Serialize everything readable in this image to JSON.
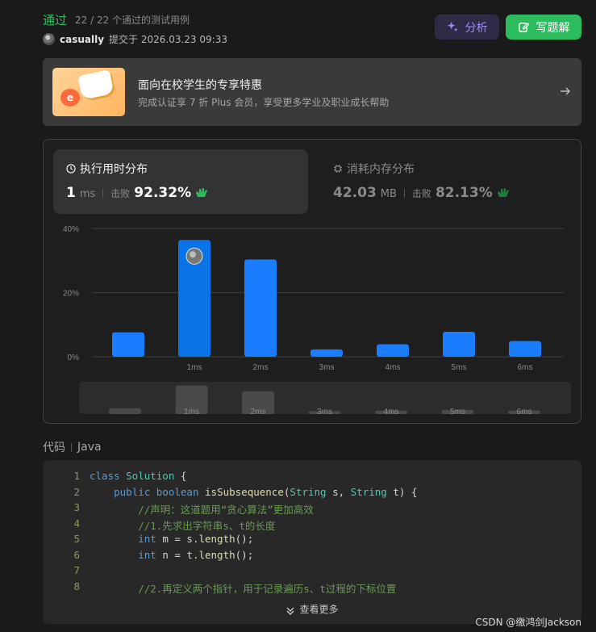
{
  "submission": {
    "status": "通过",
    "passed": "22 / 22 个通过的测试用例",
    "user": "casually",
    "submitted_at": "提交于 2026.03.23 09:33"
  },
  "actions": {
    "analyze": "分析",
    "write_solution": "写题解"
  },
  "promo": {
    "title": "面向在校学生的专享特惠",
    "subtitle": "完成认证享 7 折 Plus 会员，享受更多学业及职业成长帮助"
  },
  "runtime": {
    "label": "执行用时分布",
    "value": "1",
    "unit": "ms",
    "beat_label": "击败",
    "beat": "92.32%"
  },
  "memory": {
    "label": "消耗内存分布",
    "value": "42.03",
    "unit": "MB",
    "beat_label": "击败",
    "beat": "82.13%"
  },
  "chart_data": {
    "type": "bar",
    "categories": [
      "",
      "1ms",
      "2ms",
      "3ms",
      "4ms",
      "5ms",
      "6ms"
    ],
    "values": [
      7.6,
      36.4,
      30.3,
      2.3,
      3.9,
      7.8,
      4.9
    ],
    "y_ticks": [
      "40%",
      "20%",
      "0%"
    ],
    "ylim": [
      0,
      40
    ],
    "highlight_index": 1,
    "highlight_color": "#0a74e6",
    "bar_color": "#1a7cff",
    "overview_values": [
      1.8,
      8.8,
      7.1,
      0.9,
      1.1,
      1.3,
      1.1
    ]
  },
  "code": {
    "title": "代码",
    "language": "Java",
    "lines": [
      [
        {
          "t": "class ",
          "c": "kw"
        },
        {
          "t": "Solution",
          "c": "ty"
        },
        {
          "t": " {",
          "c": "pl"
        }
      ],
      [
        {
          "t": "    ",
          "c": "pl"
        },
        {
          "t": "public ",
          "c": "kw"
        },
        {
          "t": "boolean ",
          "c": "kw"
        },
        {
          "t": "isSubsequence",
          "c": "fn"
        },
        {
          "t": "(",
          "c": "pl"
        },
        {
          "t": "String",
          "c": "ty"
        },
        {
          "t": " s, ",
          "c": "pl"
        },
        {
          "t": "String",
          "c": "ty"
        },
        {
          "t": " t) {",
          "c": "pl"
        }
      ],
      [
        {
          "t": "        //声明：这道题用“贪心算法”更加高效",
          "c": "cm"
        }
      ],
      [
        {
          "t": "        //1.先求出字符串s、t的长度",
          "c": "cm"
        }
      ],
      [
        {
          "t": "        ",
          "c": "pl"
        },
        {
          "t": "int",
          "c": "kw"
        },
        {
          "t": " m = s.",
          "c": "pl"
        },
        {
          "t": "length",
          "c": "fn"
        },
        {
          "t": "();",
          "c": "pl"
        }
      ],
      [
        {
          "t": "        ",
          "c": "pl"
        },
        {
          "t": "int",
          "c": "kw"
        },
        {
          "t": " n = t.",
          "c": "pl"
        },
        {
          "t": "length",
          "c": "fn"
        },
        {
          "t": "();",
          "c": "pl"
        }
      ],
      [
        {
          "t": "",
          "c": "pl"
        }
      ],
      [
        {
          "t": "        //2.再定义两个指针，用于记录遍历s、t过程的下标位置",
          "c": "cm"
        }
      ]
    ],
    "more": "查看更多"
  },
  "watermark": "CSDN @缴鸿剑Jackson"
}
